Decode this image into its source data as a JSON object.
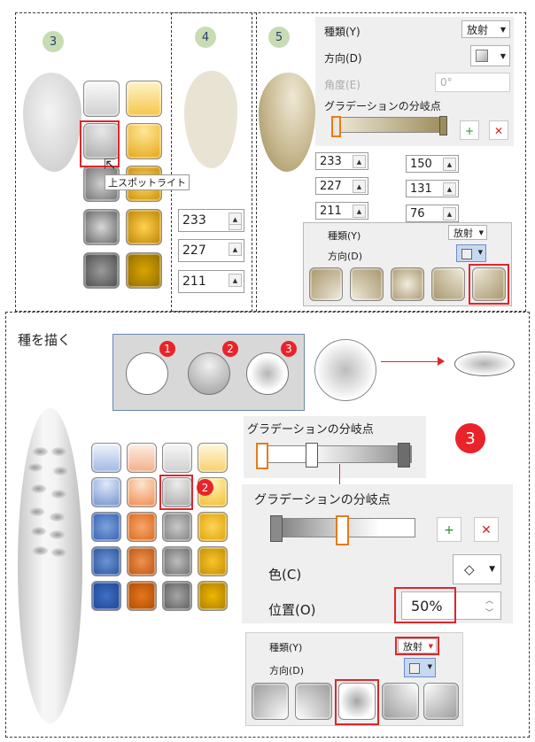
{
  "step_badges": {
    "s3": "3",
    "s4": "4",
    "s5": "5"
  },
  "tooltip": "上スポットライト",
  "rgb_left": [
    "233",
    "227",
    "211"
  ],
  "rgb_mid": [
    "233",
    "227",
    "211"
  ],
  "rgb_right": [
    "150",
    "131",
    "76"
  ],
  "top_panel": {
    "type_label": "種類(Y)",
    "type_value": "放射",
    "direction_label": "方向(D)",
    "angle_label": "角度(E)",
    "angle_value": "0°",
    "stops_label": "グラデーションの分岐点"
  },
  "small_panel": {
    "type_label": "種類(Y)",
    "type_value": "放射",
    "direction_label": "方向(D)"
  },
  "section_title": "種を描く",
  "seed_badges": [
    "1",
    "2",
    "3"
  ],
  "grid_badge": "2",
  "big_badge": "3",
  "stops_panel_top": {
    "label": "グラデーションの分岐点"
  },
  "stops_panel_bottom": {
    "label": "グラデーションの分岐点",
    "color_label": "色(C)",
    "position_label": "位置(O)",
    "position_value": "50%"
  },
  "bottom_panel": {
    "type_label": "種類(Y)",
    "type_value": "放射",
    "direction_label": "方向(D)"
  },
  "colors": {
    "accent_red": "#e0252b",
    "badge_green": "#c8dcb4",
    "panel_bg": "#efefef"
  }
}
